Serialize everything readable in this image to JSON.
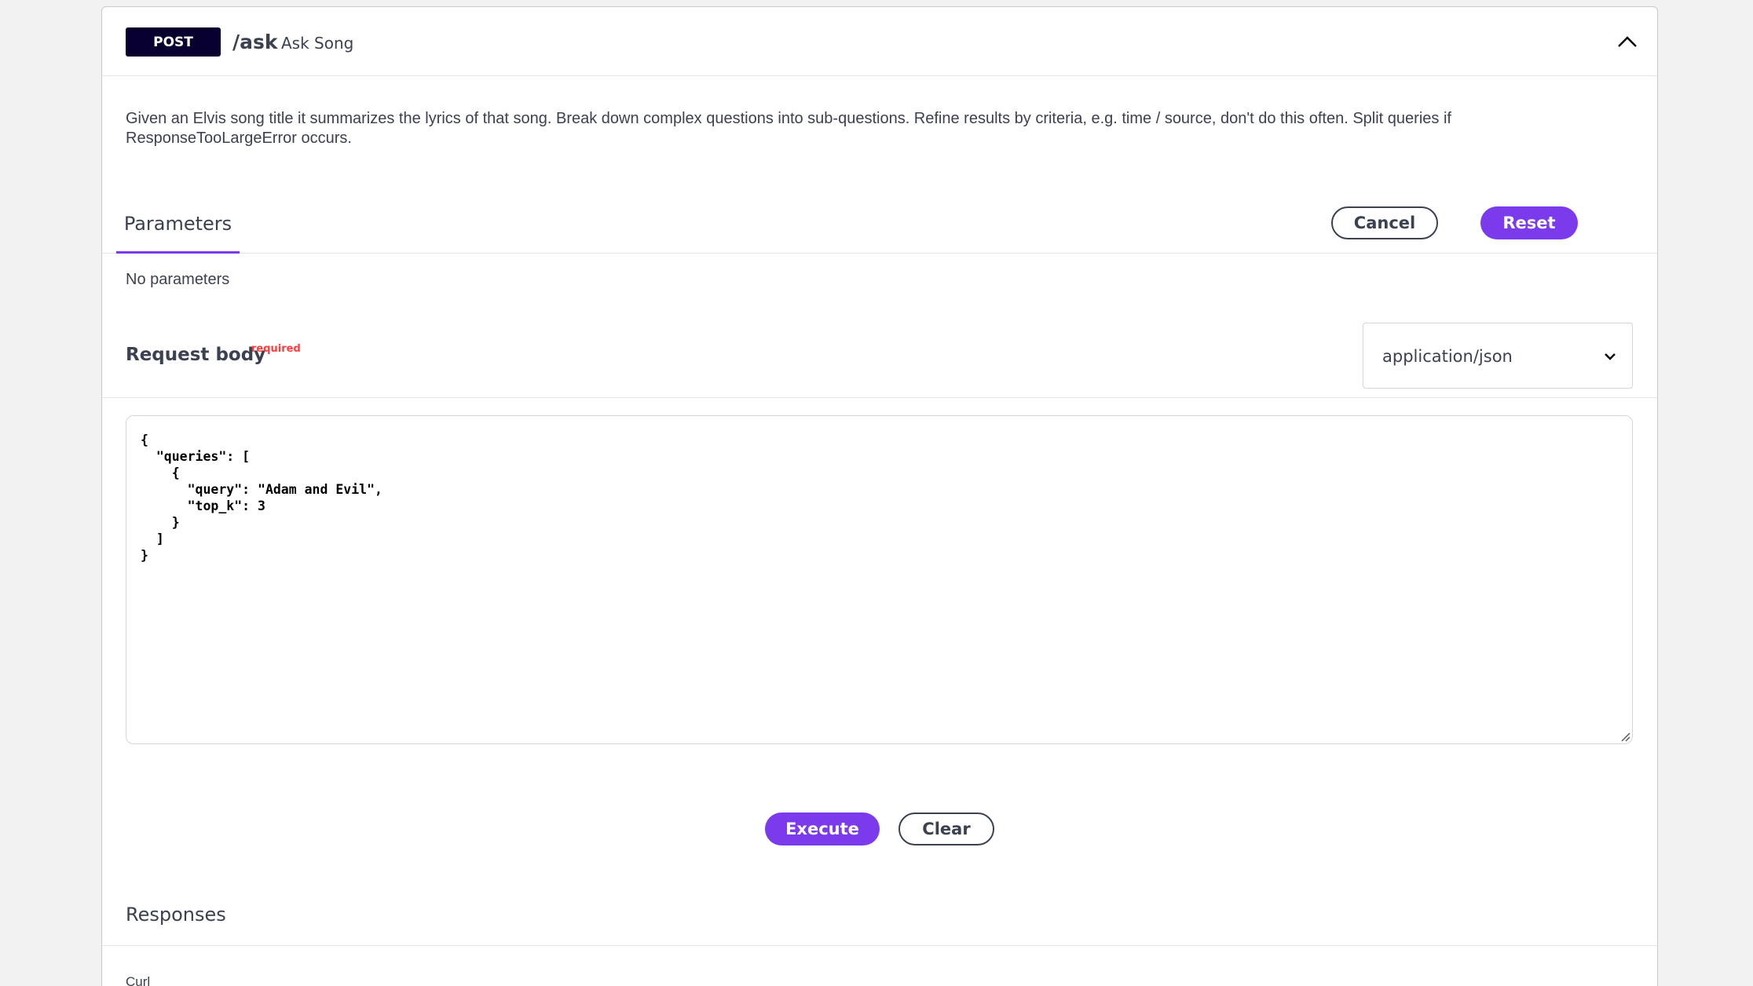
{
  "operation": {
    "method": "POST",
    "path": "/ask",
    "summary": "Ask Song",
    "description": "Given an Elvis song title it summarizes the lyrics of that song. Break down complex questions into sub-questions. Refine results by criteria, e.g. time / source, don't do this often. Split queries if ResponseTooLargeError occurs.",
    "collapse_icon": "chevron-up-icon"
  },
  "parameters": {
    "tab_label": "Parameters",
    "cancel_label": "Cancel",
    "reset_label": "Reset",
    "empty_text": "No parameters"
  },
  "request_body": {
    "title": "Request body",
    "required_label": "required",
    "content_type": "application/json",
    "content_type_icon": "chevron-down-icon",
    "value": "{\n  \"queries\": [\n    {\n      \"query\": \"Adam and Evil\",\n      \"top_k\": 3\n    }\n  ]\n}"
  },
  "actions": {
    "execute_label": "Execute",
    "clear_label": "Clear"
  },
  "responses": {
    "title": "Responses",
    "curl_label": "Curl"
  },
  "colors": {
    "accent": "#7c3aed",
    "method_badge": "#07002e",
    "required": "#ff3b3b",
    "text": "#3b4151"
  }
}
